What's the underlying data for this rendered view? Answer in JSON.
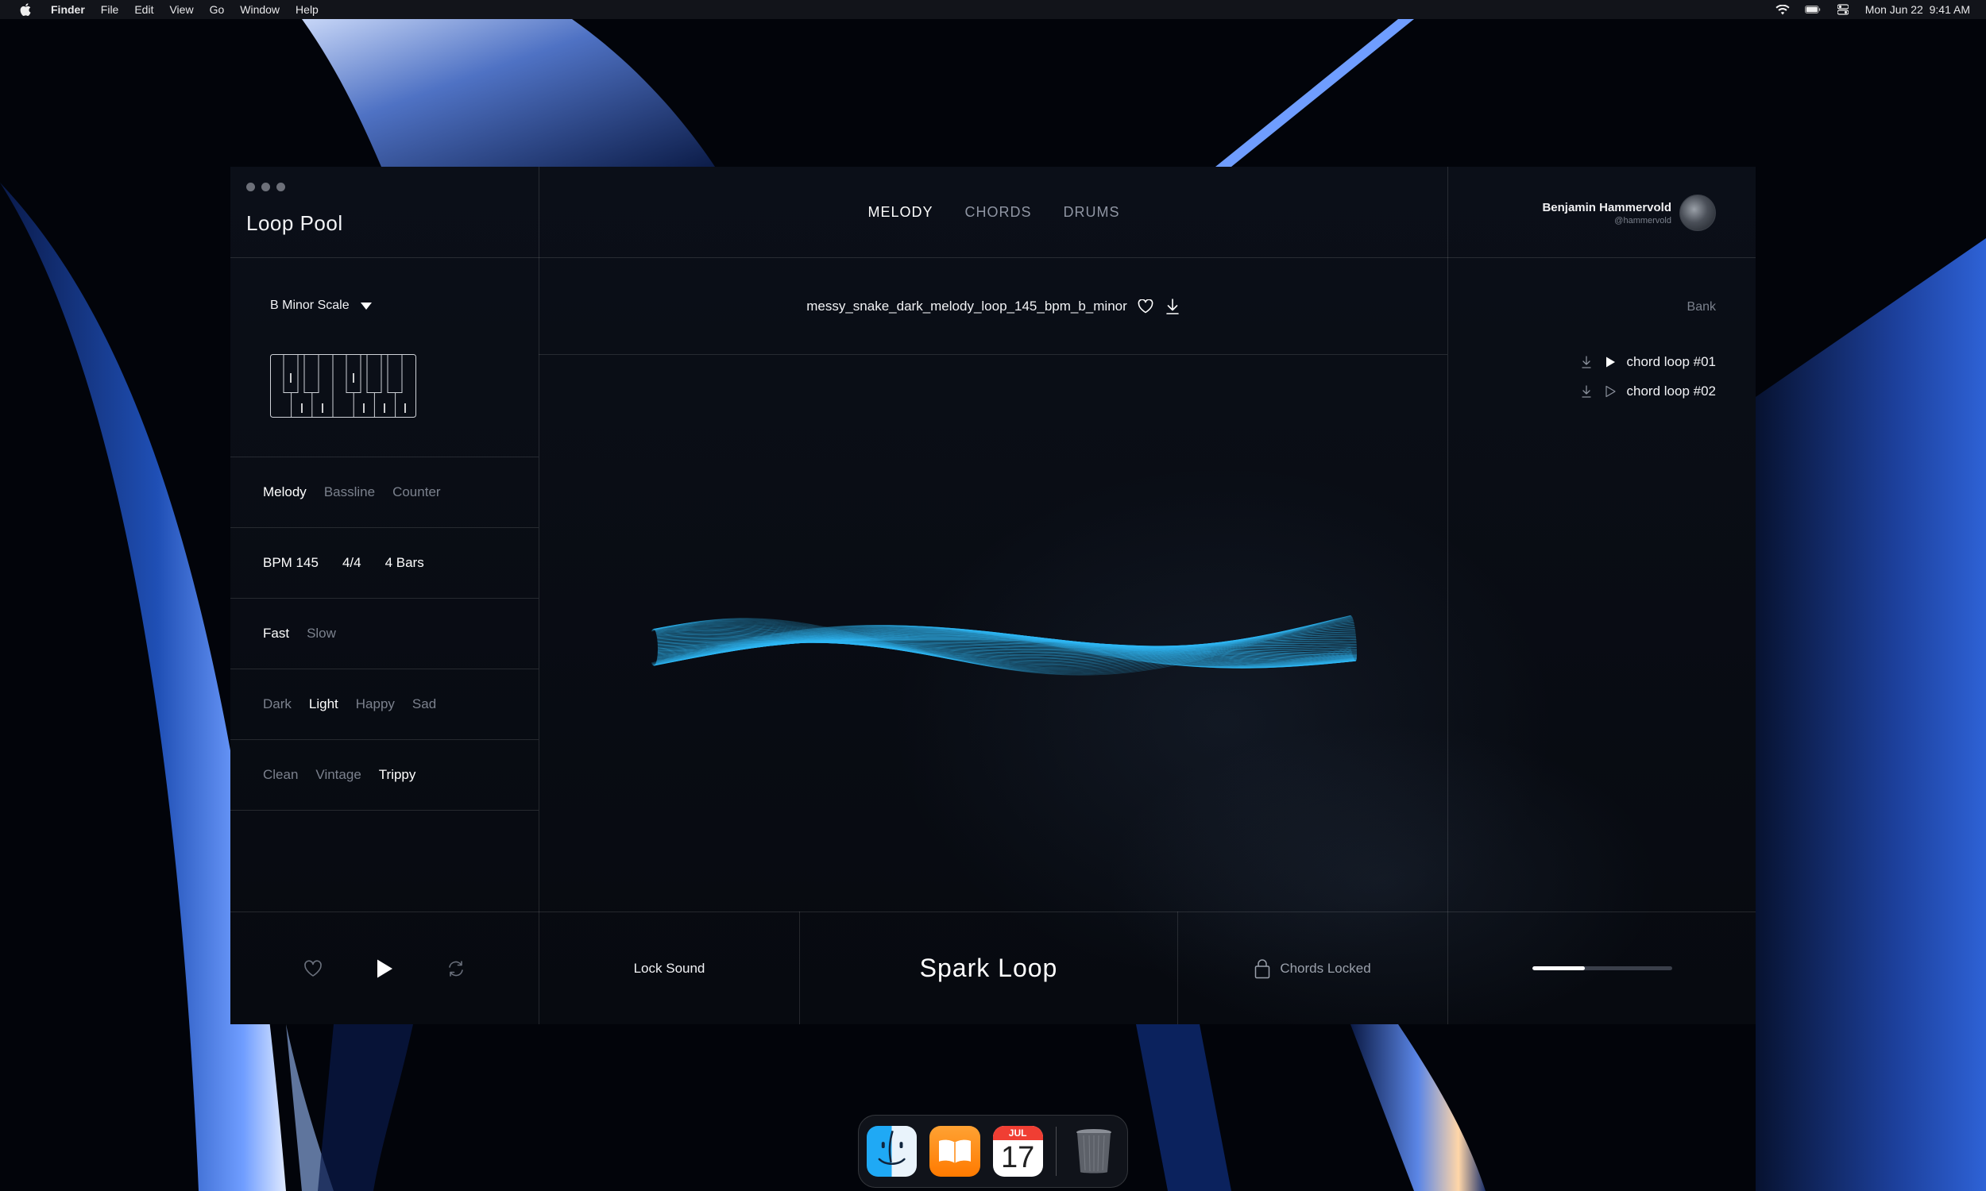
{
  "menubar": {
    "app": "Finder",
    "items": [
      "File",
      "Edit",
      "View",
      "Go",
      "Window",
      "Help"
    ],
    "datetime": "Mon Jun 22  9:41 AM"
  },
  "app": {
    "title": "Loop Pool",
    "tabs": [
      {
        "label": "MELODY",
        "active": true
      },
      {
        "label": "CHORDS",
        "active": false
      },
      {
        "label": "DRUMS",
        "active": false
      }
    ],
    "user": {
      "name": "Benjamin Hammervold",
      "handle": "@hammervold"
    }
  },
  "left_panel": {
    "scale": "B Minor Scale",
    "parts": [
      "Melody",
      "Bassline",
      "Counter"
    ],
    "tempo": {
      "bpm": "BPM 145",
      "signature": "4/4",
      "bars": "4 Bars"
    },
    "speed": [
      "Fast",
      "Slow"
    ],
    "mood": [
      "Dark",
      "Light",
      "Happy",
      "Sad"
    ],
    "texture": [
      "Clean",
      "Vintage",
      "Trippy"
    ]
  },
  "center": {
    "filename": "messy_snake_dark_melody_loop_145_bpm_b_minor"
  },
  "right_panel": {
    "bank_label": "Bank",
    "loops": [
      "chord loop #01",
      "chord loop #02"
    ]
  },
  "bottom": {
    "lock_sound": "Lock Sound",
    "spark_loop": "Spark Loop",
    "chords_locked": "Chords Locked",
    "progress_fraction": 0.38
  },
  "dock": {
    "calendar_month": "JUL",
    "calendar_day": "17"
  },
  "colors": {
    "accent_wave": "#2fb8f5",
    "background": "#070a10"
  }
}
